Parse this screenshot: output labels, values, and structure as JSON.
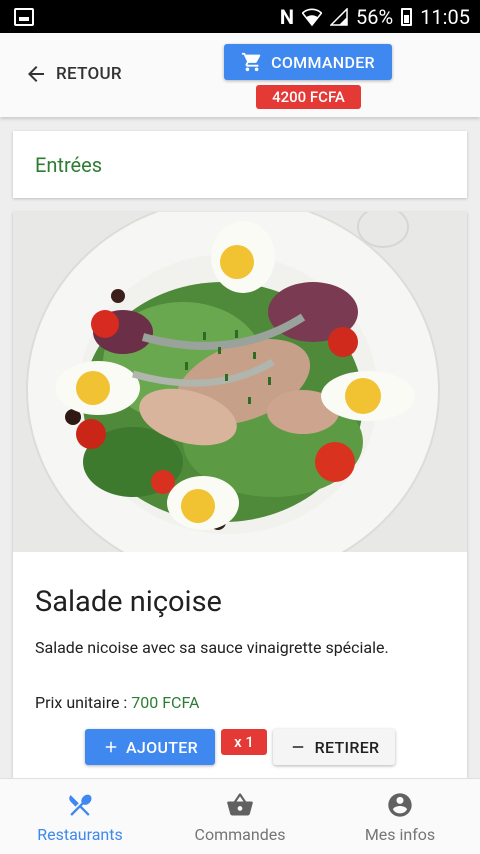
{
  "status_bar": {
    "network_letter": "N",
    "battery": "56%",
    "time": "11:05"
  },
  "header": {
    "back_label": "RETOUR",
    "order_label": "COMMANDER",
    "total": "4200 FCFA"
  },
  "category": {
    "title": "Entrées"
  },
  "product": {
    "name": "Salade niçoise",
    "description": "Salade nicoise avec sa sauce vinaigrette spéciale.",
    "price_label": "Prix unitaire : ",
    "price_value": "700 FCFA",
    "add_label": "AJOUTER",
    "quantity": "x 1",
    "remove_label": "RETIRER"
  },
  "bottom_nav": {
    "items": [
      {
        "label": "Restaurants",
        "icon": "fork-knife-icon",
        "active": true
      },
      {
        "label": "Commandes",
        "icon": "basket-icon",
        "active": false
      },
      {
        "label": "Mes infos",
        "icon": "account-circle-icon",
        "active": false
      }
    ]
  },
  "colors": {
    "accent": "#3f88f0",
    "badge_red": "#e53935",
    "green_text": "#2e7d32",
    "status_bar": "#000000"
  }
}
